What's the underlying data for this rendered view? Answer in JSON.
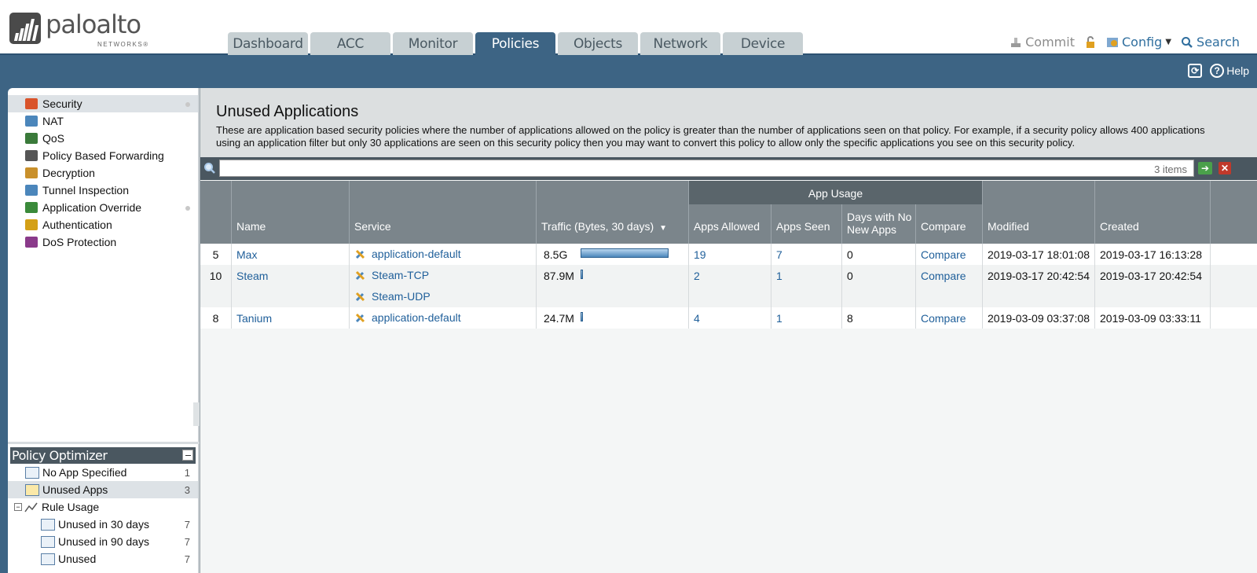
{
  "logo": {
    "word": "paloalto",
    "sub": "NETWORKS®"
  },
  "tabs": [
    {
      "label": "Dashboard",
      "active": false
    },
    {
      "label": "ACC",
      "active": false
    },
    {
      "label": "Monitor",
      "active": false
    },
    {
      "label": "Policies",
      "active": true
    },
    {
      "label": "Objects",
      "active": false
    },
    {
      "label": "Network",
      "active": false
    },
    {
      "label": "Device",
      "active": false
    }
  ],
  "top_actions": {
    "commit": "Commit",
    "config": "Config",
    "search": "Search"
  },
  "band": {
    "help": "Help"
  },
  "nav": {
    "items": [
      {
        "label": "Security",
        "icon": "firewall-icon",
        "color": "#d9542b"
      },
      {
        "label": "NAT",
        "icon": "nat-icon",
        "color": "#4b86bb"
      },
      {
        "label": "QoS",
        "icon": "qos-icon",
        "color": "#3a7a3a"
      },
      {
        "label": "Policy Based Forwarding",
        "icon": "pbf-icon",
        "color": "#555555"
      },
      {
        "label": "Decryption",
        "icon": "lock-icon",
        "color": "#c9902b"
      },
      {
        "label": "Tunnel Inspection",
        "icon": "tunnel-icon",
        "color": "#4b86bb"
      },
      {
        "label": "Application Override",
        "icon": "app-override-icon",
        "color": "#3a8a3a"
      },
      {
        "label": "Authentication",
        "icon": "auth-icon",
        "color": "#d4a017"
      },
      {
        "label": "DoS Protection",
        "icon": "dos-icon",
        "color": "#8a3a8a"
      }
    ]
  },
  "optimizer": {
    "title": "Policy Optimizer",
    "items": [
      {
        "label": "No App Specified",
        "count": "1"
      },
      {
        "label": "Unused Apps",
        "count": "3"
      },
      {
        "label": "Rule Usage",
        "count": ""
      },
      {
        "label": "Unused in 30 days",
        "count": "7"
      },
      {
        "label": "Unused in 90 days",
        "count": "7"
      },
      {
        "label": "Unused",
        "count": "7"
      }
    ]
  },
  "main": {
    "title": "Unused Applications",
    "description": "These are application based security policies where the number of applications allowed on the policy is greater than the number of applications seen on that policy. For example, if a security policy allows 400 applications using an application filter but only 30 applications are seen on this security policy then you may want to convert this policy to allow only the specific applications you see on this security policy.",
    "items_count": "3 items"
  },
  "table": {
    "headers": {
      "name": "Name",
      "service": "Service",
      "traffic": "Traffic (Bytes, 30 days)",
      "app_usage": "App Usage",
      "apps_allowed": "Apps Allowed",
      "apps_seen": "Apps Seen",
      "days_no_new": "Days with No New Apps",
      "compare": "Compare",
      "modified": "Modified",
      "created": "Created"
    },
    "rows": [
      {
        "num": "5",
        "name": "Max",
        "services": [
          "application-default"
        ],
        "traffic": "8.5G",
        "traffic_fraction": 1.0,
        "apps_allowed": "19",
        "apps_seen": "7",
        "days": "0",
        "compare": "Compare",
        "modified": "2019-03-17 18:01:08",
        "created": "2019-03-17 16:13:28"
      },
      {
        "num": "10",
        "name": "Steam",
        "services": [
          "Steam-TCP",
          "Steam-UDP"
        ],
        "traffic": "87.9M",
        "traffic_fraction": 0.01,
        "apps_allowed": "2",
        "apps_seen": "1",
        "days": "0",
        "compare": "Compare",
        "modified": "2019-03-17 20:42:54",
        "created": "2019-03-17 20:42:54"
      },
      {
        "num": "8",
        "name": "Tanium",
        "services": [
          "application-default"
        ],
        "traffic": "24.7M",
        "traffic_fraction": 0.003,
        "apps_allowed": "4",
        "apps_seen": "1",
        "days": "8",
        "compare": "Compare",
        "modified": "2019-03-09 03:37:08",
        "created": "2019-03-09 03:33:11"
      }
    ]
  }
}
